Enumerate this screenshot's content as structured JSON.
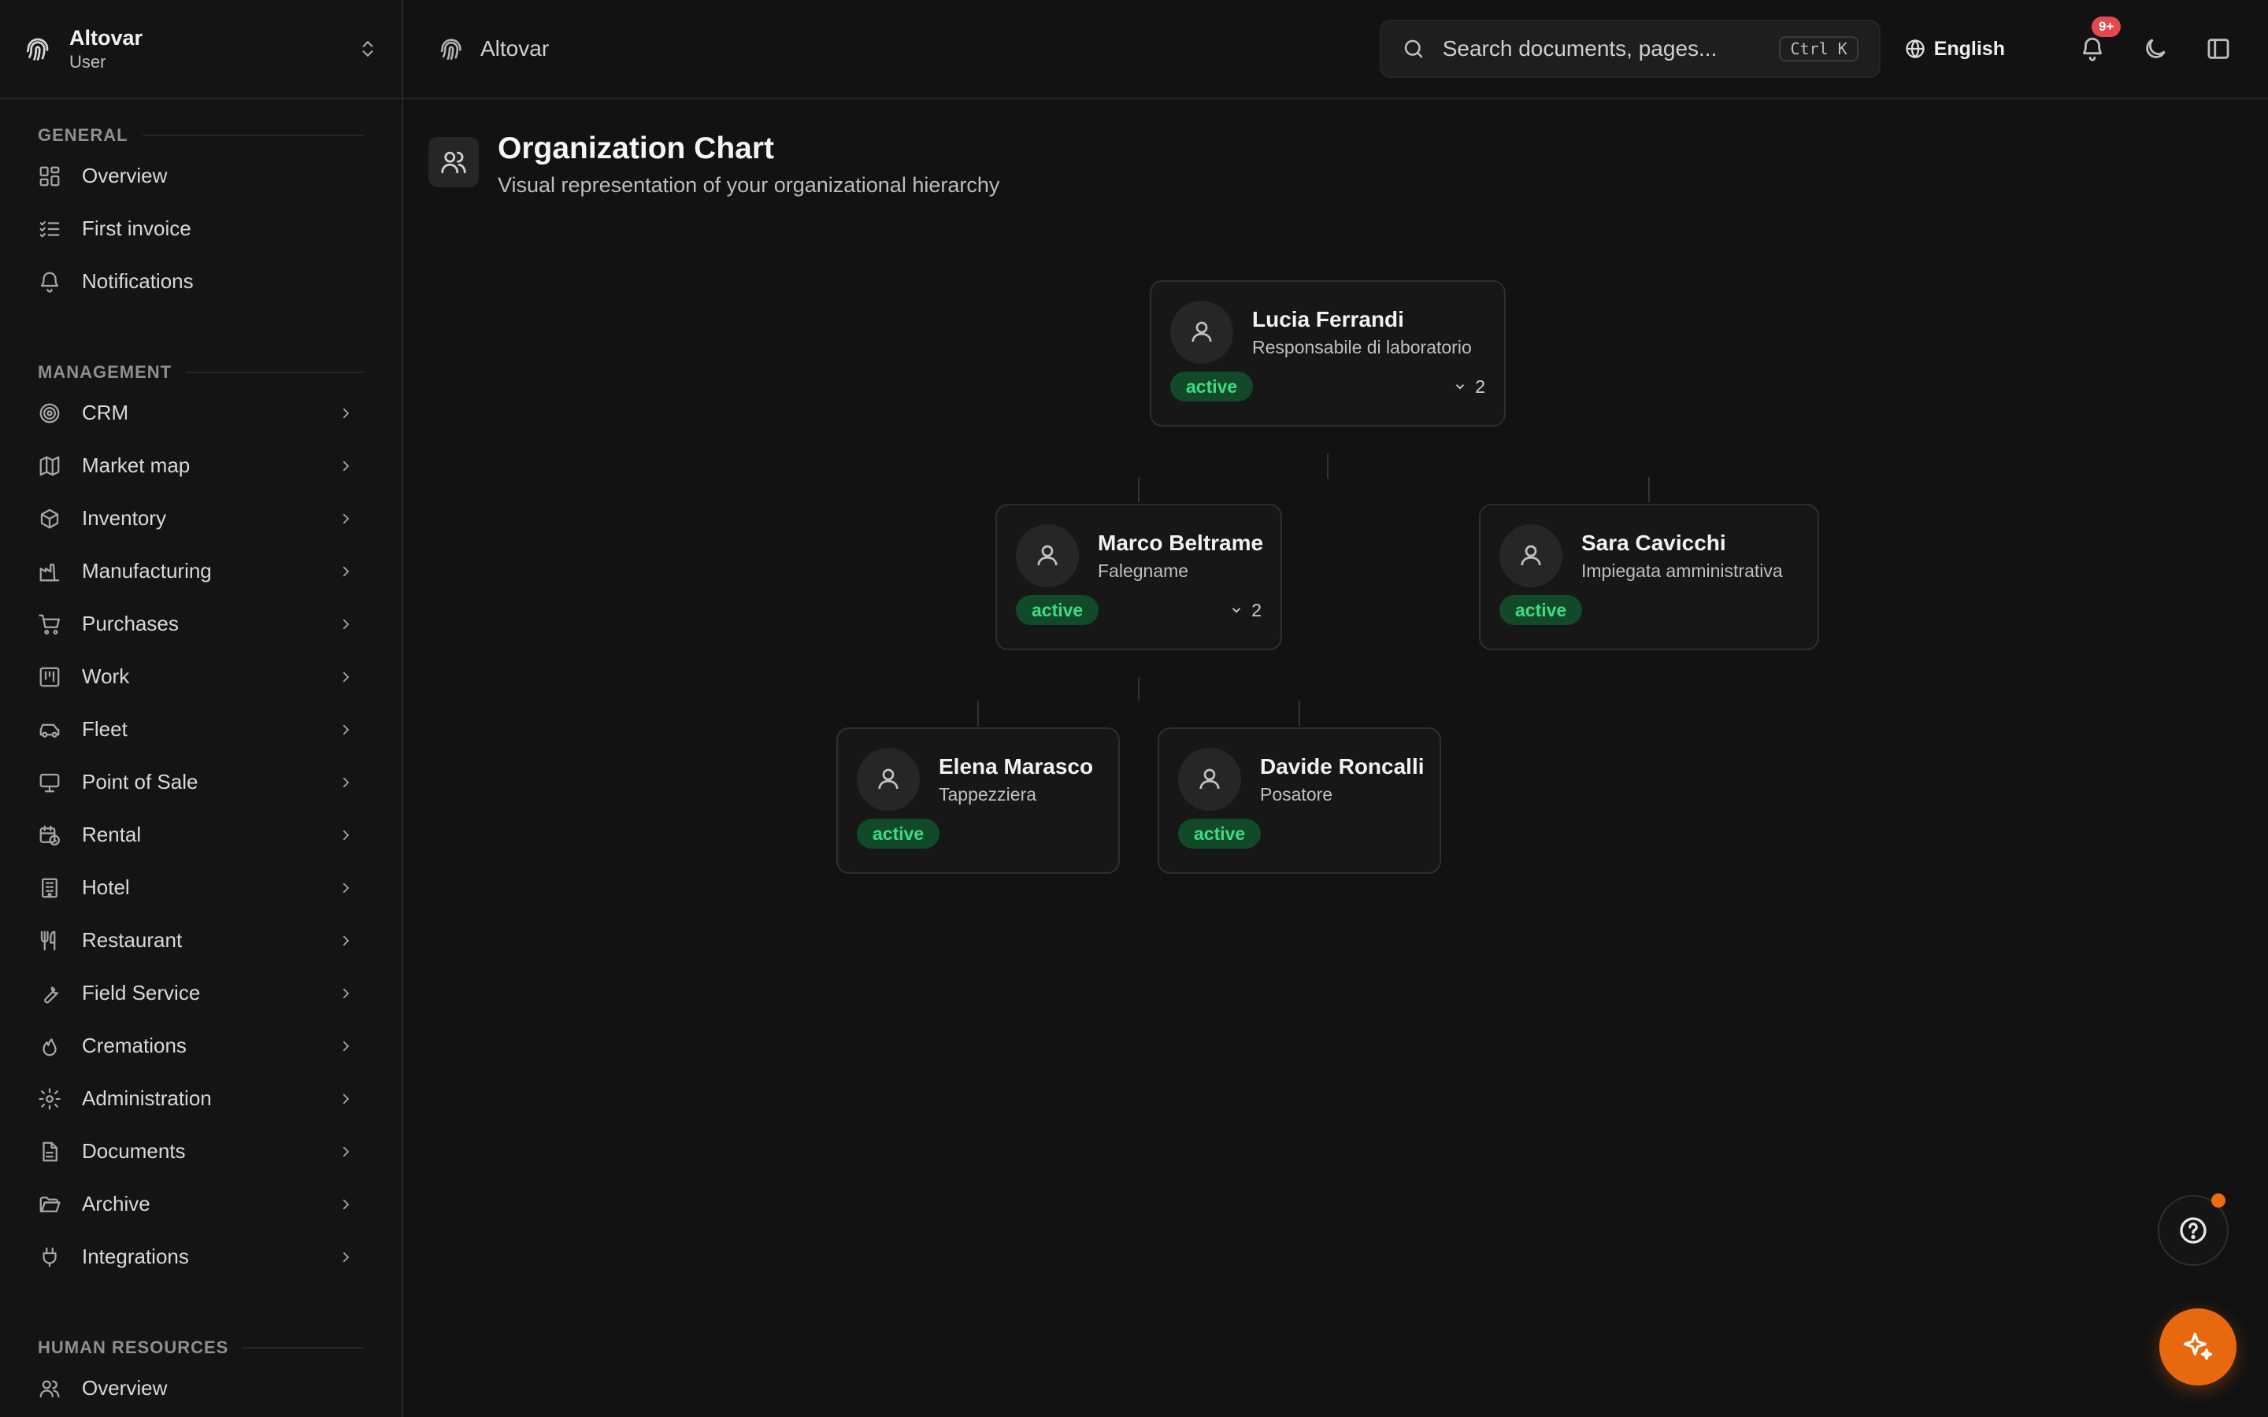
{
  "brand": {
    "name": "Altovar",
    "role": "User"
  },
  "header": {
    "breadcrumb": "Altovar",
    "search_placeholder": "Search documents, pages...",
    "search_shortcut": "Ctrl K",
    "language": "English",
    "notification_badge": "9+"
  },
  "sidebar": {
    "general_label": "GENERAL",
    "general": [
      {
        "label": "Overview",
        "icon": "dashboard-icon"
      },
      {
        "label": "First invoice",
        "icon": "checklist-icon"
      },
      {
        "label": "Notifications",
        "icon": "bell-icon"
      }
    ],
    "management_label": "MANAGEMENT",
    "management": [
      {
        "label": "CRM",
        "icon": "target-icon"
      },
      {
        "label": "Market map",
        "icon": "map-icon"
      },
      {
        "label": "Inventory",
        "icon": "box-icon"
      },
      {
        "label": "Manufacturing",
        "icon": "factory-icon"
      },
      {
        "label": "Purchases",
        "icon": "cart-icon"
      },
      {
        "label": "Work",
        "icon": "kanban-icon"
      },
      {
        "label": "Fleet",
        "icon": "car-icon"
      },
      {
        "label": "Point of Sale",
        "icon": "monitor-icon"
      },
      {
        "label": "Rental",
        "icon": "calendar-clock-icon"
      },
      {
        "label": "Hotel",
        "icon": "building-icon"
      },
      {
        "label": "Restaurant",
        "icon": "utensils-icon"
      },
      {
        "label": "Field Service",
        "icon": "wrench-icon"
      },
      {
        "label": "Cremations",
        "icon": "flame-icon"
      },
      {
        "label": "Administration",
        "icon": "gear-icon"
      },
      {
        "label": "Documents",
        "icon": "file-icon"
      },
      {
        "label": "Archive",
        "icon": "folder-open-icon"
      },
      {
        "label": "Integrations",
        "icon": "plug-icon"
      }
    ],
    "hr_label": "HUMAN RESOURCES",
    "hr": [
      {
        "label": "Overview",
        "icon": "users-icon"
      }
    ]
  },
  "page": {
    "title": "Organization Chart",
    "subtitle": "Visual representation of your organizational hierarchy"
  },
  "org": {
    "root": {
      "name": "Lucia Ferrandi",
      "role": "Responsabile di laboratorio",
      "status": "active",
      "reports": "2"
    },
    "level2": [
      {
        "name": "Marco Beltrame",
        "role": "Falegname",
        "status": "active",
        "reports": "2"
      },
      {
        "name": "Sara Cavicchi",
        "role": "Impiegata amministrativa",
        "status": "active"
      }
    ],
    "level3": [
      {
        "name": "Elena Marasco",
        "role": "Tappezziera",
        "status": "active"
      },
      {
        "name": "Davide Roncalli",
        "role": "Posatore",
        "status": "active"
      }
    ]
  },
  "colors": {
    "accent": "#e8680f",
    "status_bg": "#124a29",
    "status_fg": "#3ddc84",
    "badge": "#e5484d"
  }
}
